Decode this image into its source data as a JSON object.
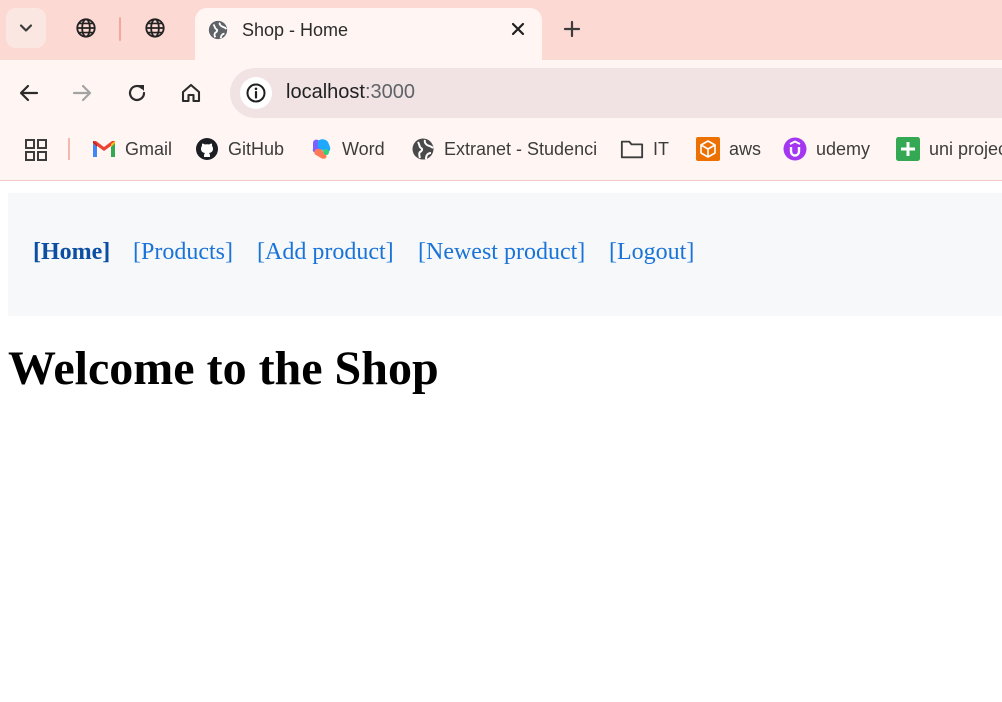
{
  "browser": {
    "active_tab": {
      "title": "Shop - Home",
      "icon": "globe-icon"
    },
    "pinned_tabs": [
      {
        "icon": "globe-icon"
      },
      {
        "icon": "globe-icon"
      }
    ],
    "address": {
      "host": "localhost",
      "port": ":3000"
    },
    "bookmarks": [
      {
        "label": "Gmail",
        "icon": "gmail-icon"
      },
      {
        "label": "GitHub",
        "icon": "github-icon"
      },
      {
        "label": "Word",
        "icon": "word-icon"
      },
      {
        "label": "Extranet - Studenci",
        "icon": "globe-icon"
      },
      {
        "label": "IT",
        "icon": "folder-icon"
      },
      {
        "label": "aws",
        "icon": "aws-icon"
      },
      {
        "label": "udemy",
        "icon": "udemy-icon"
      },
      {
        "label": "uni projec",
        "icon": "sheets-icon"
      }
    ],
    "colors": {
      "tabstrip": "#fdd9d3",
      "toolbar": "#fff6f4",
      "omnibox": "#f1e3e3"
    }
  },
  "site": {
    "nav": [
      {
        "label": "[Home]",
        "active": true
      },
      {
        "label": "[Products]",
        "active": false
      },
      {
        "label": "[Add product]",
        "active": false
      },
      {
        "label": "[Newest product]",
        "active": false
      },
      {
        "label": "[Logout]",
        "active": false
      }
    ],
    "heading": "Welcome to the Shop",
    "colors": {
      "link": "#1a73d8",
      "active_link": "#0b4ea2",
      "nav_bg": "#f6f8f9"
    }
  }
}
